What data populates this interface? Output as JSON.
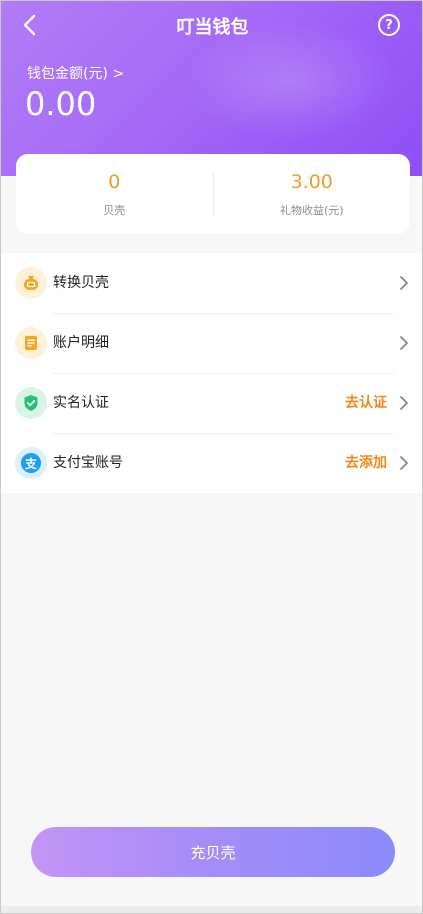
{
  "header": {
    "title": "叮当钱包",
    "back_icon": "back-arrow-icon",
    "help_icon": "help-icon",
    "help_glyph": "?",
    "wallet_label": "钱包金额(元) >",
    "wallet_amount": "0.00"
  },
  "stats": [
    {
      "value": "0",
      "label": "贝壳"
    },
    {
      "value": "3.00",
      "label": "礼物收益(元)"
    }
  ],
  "menu": [
    {
      "label": "转换贝壳",
      "action": "",
      "icon": "shell-exchange-icon"
    },
    {
      "label": "账户明细",
      "action": "",
      "icon": "account-details-icon"
    },
    {
      "label": "实名认证",
      "action": "去认证",
      "icon": "shield-verify-icon"
    },
    {
      "label": "支付宝账号",
      "action": "去添加",
      "icon": "alipay-icon",
      "icon_glyph": "支"
    }
  ],
  "recharge_button": "充贝壳",
  "colors": {
    "accent_orange": "#f29a2e",
    "header_purple": "#9a5cf6",
    "button_start": "#c394f5",
    "button_end": "#8c8bfc"
  }
}
